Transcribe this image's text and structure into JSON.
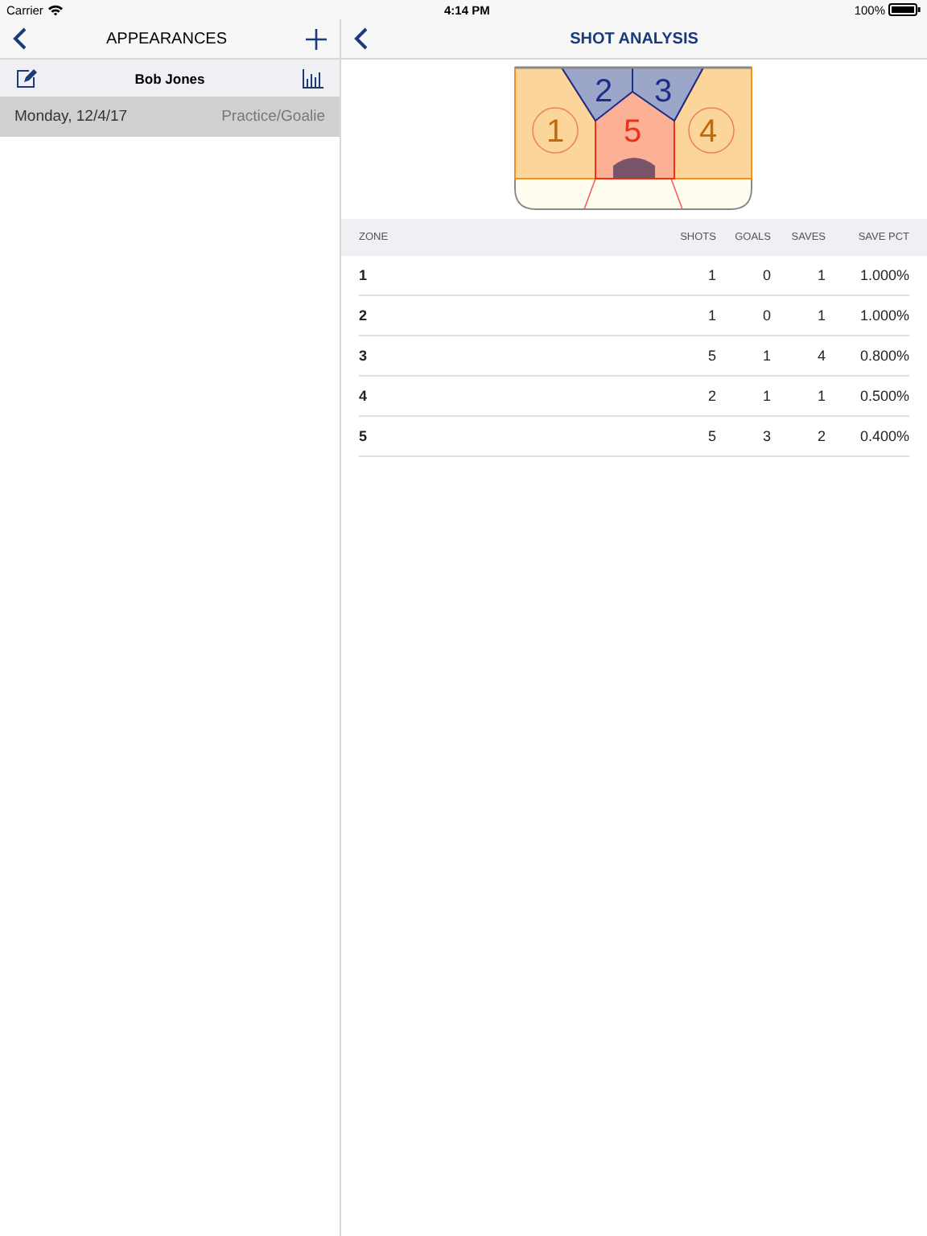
{
  "status_bar": {
    "carrier": "Carrier",
    "time": "4:14 PM",
    "battery": "100%"
  },
  "left": {
    "title": "APPEARANCES",
    "player": "Bob Jones",
    "items": [
      {
        "date": "Monday, 12/4/17",
        "type": "Practice/Goalie",
        "selected": true
      }
    ]
  },
  "right": {
    "title": "SHOT ANALYSIS",
    "rink_zones": [
      {
        "label": "2"
      },
      {
        "label": "3"
      },
      {
        "label": "1"
      },
      {
        "label": "5"
      },
      {
        "label": "4"
      }
    ],
    "table": {
      "columns": [
        "ZONE",
        "SHOTS",
        "GOALS",
        "SAVES",
        "SAVE PCT"
      ],
      "rows": [
        [
          "1",
          "1",
          "0",
          "1",
          "1.000%"
        ],
        [
          "2",
          "1",
          "0",
          "1",
          "1.000%"
        ],
        [
          "3",
          "5",
          "1",
          "4",
          "0.800%"
        ],
        [
          "4",
          "2",
          "1",
          "1",
          "0.500%"
        ],
        [
          "5",
          "5",
          "3",
          "2",
          "0.400%"
        ]
      ]
    }
  }
}
